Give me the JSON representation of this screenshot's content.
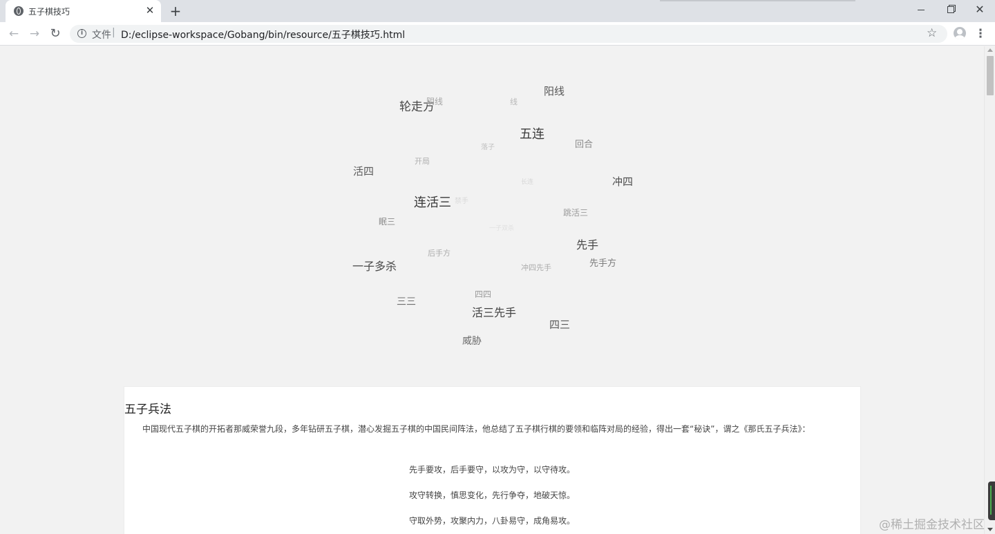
{
  "browser": {
    "tab_title": "五子棋技巧",
    "tab_close": "✕",
    "new_tab": "+",
    "address": {
      "scheme_label": "文件",
      "separator": "|",
      "url": "D:/eclipse-workspace/Gobang/bin/resource/五子棋技巧.html"
    },
    "icons": {
      "back": "←",
      "forward": "→",
      "reload": "↻",
      "info": "i",
      "star": "☆",
      "menu": "⋮",
      "close_window": "✕"
    }
  },
  "word_cloud": [
    {
      "text": "轮走方",
      "color": "#4a4a4a"
    },
    {
      "text": "阴线",
      "color": "#a6a6a6"
    },
    {
      "text": "线",
      "color": "#b8b8b8"
    },
    {
      "text": "阳线",
      "color": "#555555"
    },
    {
      "text": "五连",
      "color": "#3c3c3c"
    },
    {
      "text": "落子",
      "color": "#c2c2c2"
    },
    {
      "text": "回合",
      "color": "#8a8a8a"
    },
    {
      "text": "开局",
      "color": "#b0b0b0"
    },
    {
      "text": "活四",
      "color": "#5c5c5c"
    },
    {
      "text": "冲四",
      "color": "#4e4e4e"
    },
    {
      "text": "长连",
      "color": "#d6d6d6"
    },
    {
      "text": "连活三",
      "color": "#383838"
    },
    {
      "text": "禁手",
      "color": "#d9d9d9"
    },
    {
      "text": "跳活三",
      "color": "#9b9b9b"
    },
    {
      "text": "眠三",
      "color": "#8a8a8a"
    },
    {
      "text": "一子双杀",
      "color": "#dfdfdf"
    },
    {
      "text": "先手",
      "color": "#454545"
    },
    {
      "text": "后手方",
      "color": "#acacac"
    },
    {
      "text": "先手方",
      "color": "#7d7d7d"
    },
    {
      "text": "一子多杀",
      "color": "#4a4a4a"
    },
    {
      "text": "冲四先手",
      "color": "#acacac"
    },
    {
      "text": "四四",
      "color": "#9a9a9a"
    },
    {
      "text": "三三",
      "color": "#6e6e6e"
    },
    {
      "text": "活三先手",
      "color": "#404040"
    },
    {
      "text": "四三",
      "color": "#5a5a5a"
    },
    {
      "text": "威胁",
      "color": "#6a6a6a"
    }
  ],
  "article": {
    "title": "五子兵法",
    "intro": "中国现代五子棋的开拓者那威荣誉九段，多年钻研五子棋，潜心发掘五子棋的中国民间阵法，他总结了五子棋行棋的要领和临阵对局的经验，得出一套“秘诀”，谓之《那氏五子兵法》：",
    "verses": [
      "先手要攻，后手要守，以攻为守，以守待攻。",
      "攻守转换，慎思变化，先行争夺，地破天惊。",
      "守取外势，攻聚内力，八卦易守，成角易攻。"
    ]
  },
  "watermark": "@稀土掘金技术社区"
}
